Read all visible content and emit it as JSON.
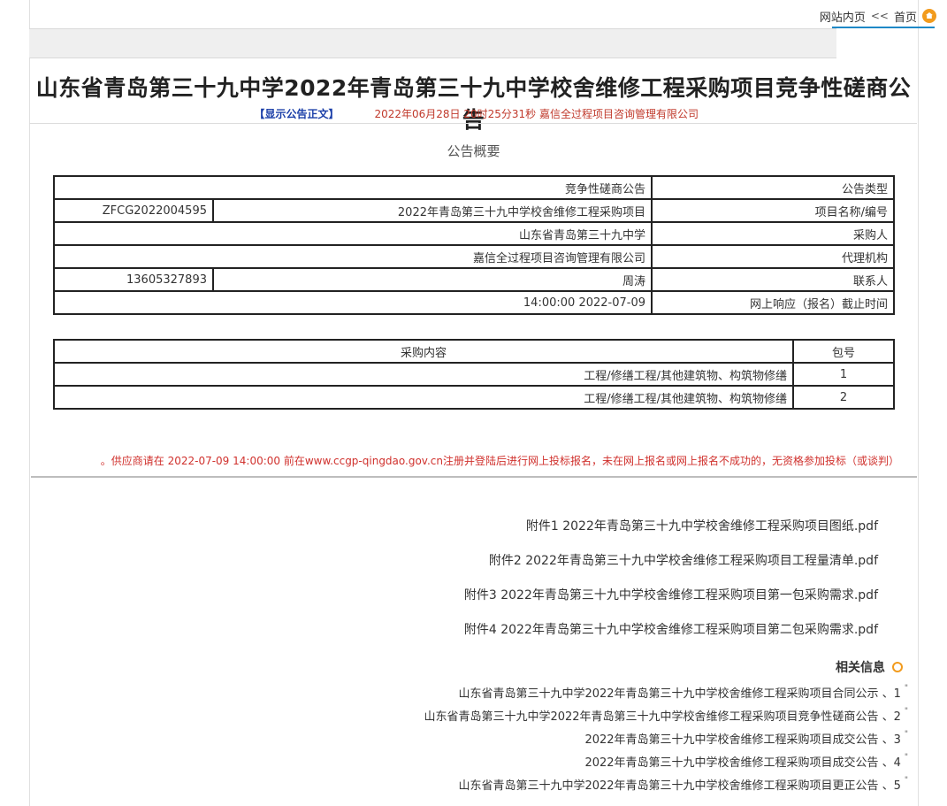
{
  "breadcrumb": {
    "home": "首页",
    "sep": ">>",
    "current": "网站内页"
  },
  "title": "山东省青岛第三十九中学2022年青岛第三十九中学校舍维修工程采购项目竞争性磋商公告",
  "meta": "2022年06月28日 20时25分31秒  嘉信全过程项目咨询管理有限公司",
  "show_text": "【显示公告正文】",
  "overview_heading": "公告概要",
  "info_table": [
    {
      "label": "公告类型",
      "value": "竞争性磋商公告"
    },
    {
      "label": "项目名称/编号",
      "value": "2022年青岛第三十九中学校舍维修工程采购项目",
      "extra": "ZFCG2022004595"
    },
    {
      "label": "采购人",
      "value": "山东省青岛第三十九中学"
    },
    {
      "label": "代理机构",
      "value": "嘉信全过程项目咨询管理有限公司"
    },
    {
      "label": "联系人",
      "value": "周涛",
      "extra": "13605327893"
    },
    {
      "label": "网上响应（报名）截止时间",
      "value": "2022-07-09 14:00:00"
    }
  ],
  "pkg_table": {
    "headers": [
      "包号",
      "采购内容"
    ],
    "rows": [
      {
        "num": "1",
        "content": "工程/修缮工程/其他建筑物、构筑物修缮"
      },
      {
        "num": "2",
        "content": "工程/修缮工程/其他建筑物、构筑物修缮"
      }
    ]
  },
  "notice": "供应商请在 2022-07-09 14:00:00 前在www.ccgp-qingdao.gov.cn注册并登陆后进行网上投标报名，未在网上报名或网上报名不成功的，无资格参加投标（或谈判）。",
  "attachments": [
    "附件1 2022年青岛第三十九中学校舍维修工程采购项目图纸.pdf",
    "附件2 2022年青岛第三十九中学校舍维修工程采购项目工程量清单.pdf",
    "附件3 2022年青岛第三十九中学校舍维修工程采购项目第一包采购需求.pdf",
    "附件4 2022年青岛第三十九中学校舍维修工程采购项目第二包采购需求.pdf"
  ],
  "related_heading": "相关信息",
  "related": [
    {
      "num": "1、",
      "text": "山东省青岛第三十九中学2022年青岛第三十九中学校舍维修工程采购项目合同公示"
    },
    {
      "num": "2、",
      "text": "山东省青岛第三十九中学2022年青岛第三十九中学校舍维修工程采购项目竞争性磋商公告"
    },
    {
      "num": "3、",
      "text": "2022年青岛第三十九中学校舍维修工程采购项目成交公告"
    },
    {
      "num": "4、",
      "text": "2022年青岛第三十九中学校舍维修工程采购项目成交公告"
    },
    {
      "num": "5、",
      "text": "山东省青岛第三十九中学2022年青岛第三十九中学校舍维修工程采购项目更正公告"
    }
  ]
}
